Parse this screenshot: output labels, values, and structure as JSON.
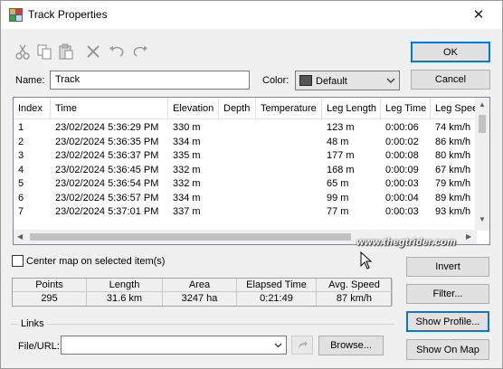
{
  "window": {
    "title": "Track Properties",
    "close_glyph": "✕"
  },
  "toolbar": {
    "icons": [
      "cut-icon",
      "copy-icon",
      "paste-icon",
      "delete-icon",
      "undo-icon",
      "redo-icon"
    ]
  },
  "buttons": {
    "ok": "OK",
    "cancel": "Cancel",
    "invert": "Invert",
    "filter": "Filter...",
    "show_profile": "Show Profile...",
    "show_on_map": "Show On Map",
    "browse": "Browse..."
  },
  "form": {
    "name_label": "Name:",
    "name_value": "Track",
    "color_label": "Color:",
    "color_value": "Default",
    "color_swatch": "#555555"
  },
  "table": {
    "columns": [
      "Index",
      "Time",
      "Elevation",
      "Depth",
      "Temperature",
      "Leg Length",
      "Leg Time",
      "Leg Speed"
    ],
    "rows": [
      [
        "1",
        "23/02/2024 5:36:29 PM",
        "330 m",
        "",
        "",
        "123 m",
        "0:00:06",
        "74 km/h"
      ],
      [
        "2",
        "23/02/2024 5:36:35 PM",
        "334 m",
        "",
        "",
        "48 m",
        "0:00:02",
        "86 km/h"
      ],
      [
        "3",
        "23/02/2024 5:36:37 PM",
        "335 m",
        "",
        "",
        "177 m",
        "0:00:08",
        "80 km/h"
      ],
      [
        "4",
        "23/02/2024 5:36:45 PM",
        "332 m",
        "",
        "",
        "168 m",
        "0:00:09",
        "67 km/h"
      ],
      [
        "5",
        "23/02/2024 5:36:54 PM",
        "332 m",
        "",
        "",
        "65 m",
        "0:00:03",
        "79 km/h"
      ],
      [
        "6",
        "23/02/2024 5:36:57 PM",
        "334 m",
        "",
        "",
        "99 m",
        "0:00:04",
        "89 km/h"
      ],
      [
        "7",
        "23/02/2024 5:37:01 PM",
        "337 m",
        "",
        "",
        "77 m",
        "0:00:03",
        "93 km/h"
      ]
    ]
  },
  "watermark": "www.thegtrider.com",
  "options": {
    "center_map_label": "Center map on selected item(s)"
  },
  "stats": [
    {
      "label": "Points",
      "value": "295"
    },
    {
      "label": "Length",
      "value": "31.6 km"
    },
    {
      "label": "Area",
      "value": "3247 ha"
    },
    {
      "label": "Elapsed Time",
      "value": "0:21:49"
    },
    {
      "label": "Avg. Speed",
      "value": "87 km/h"
    }
  ],
  "links": {
    "group_label": "Links",
    "file_label": "File/URL:",
    "file_value": ""
  }
}
